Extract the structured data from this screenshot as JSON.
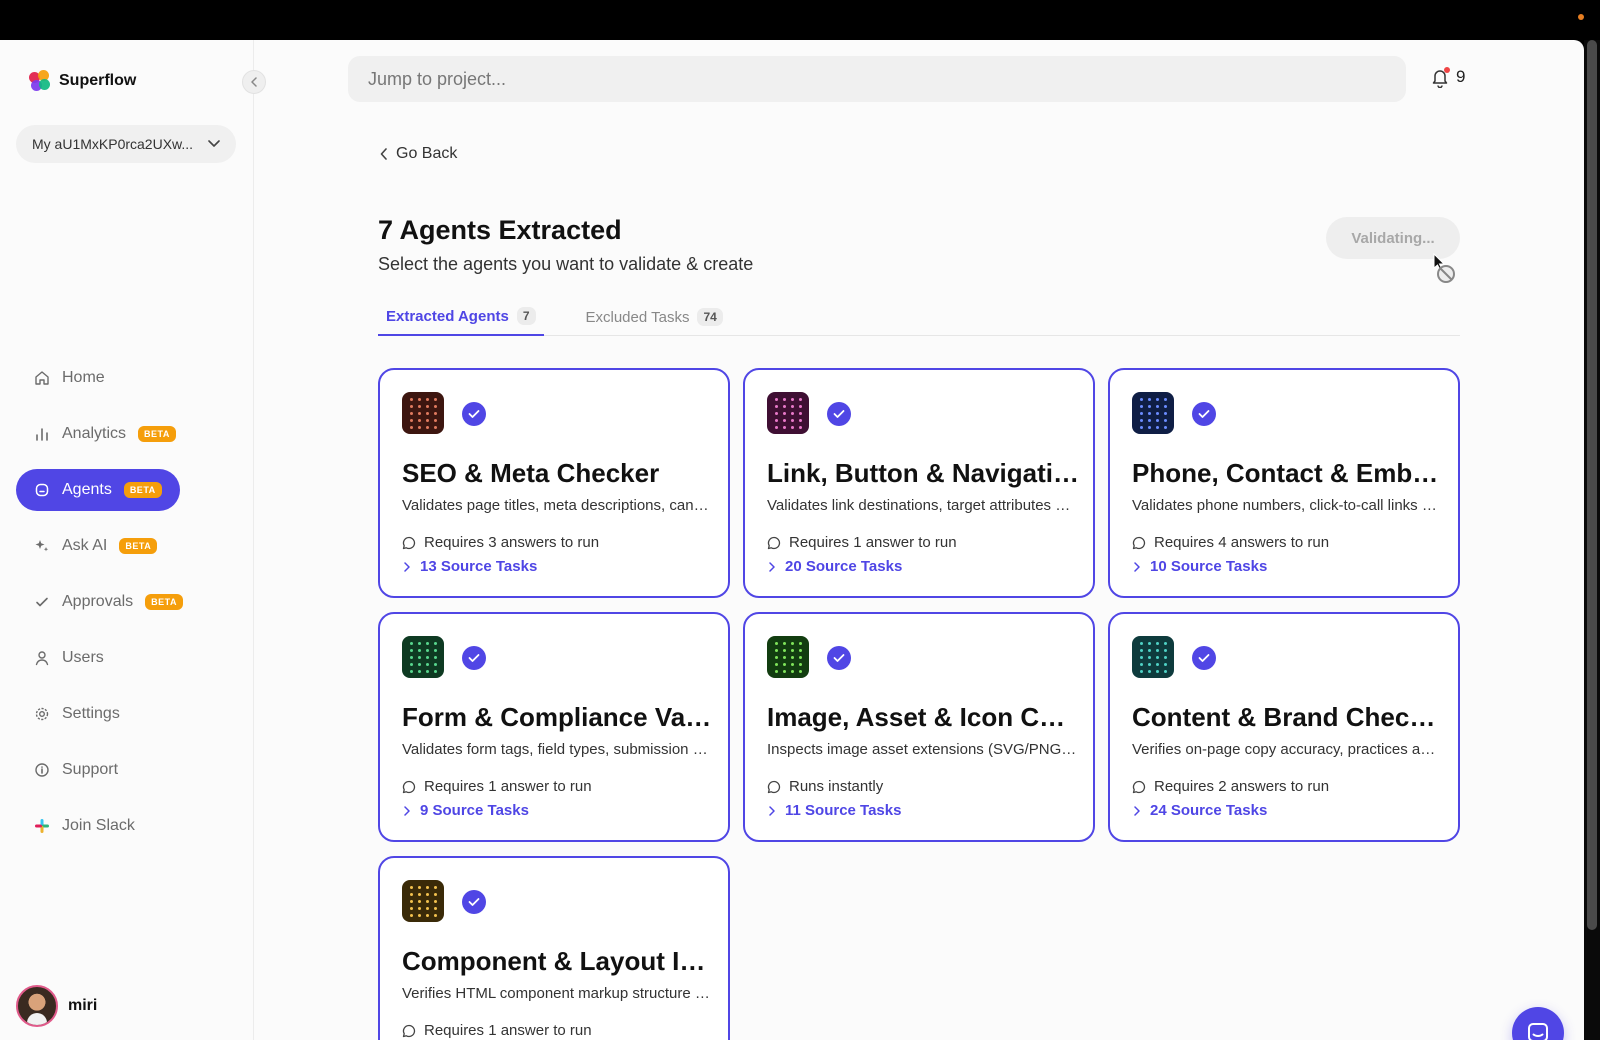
{
  "app": {
    "name": "Superflow"
  },
  "colors": {
    "accent": "#5046e5",
    "beta_badge": "#f59e0b",
    "top_dot": "#e67e22"
  },
  "sidebar": {
    "workspace_label": "My aU1MxKP0rca2UXw...",
    "items": [
      {
        "label": "Home",
        "icon": "home-icon",
        "badge": ""
      },
      {
        "label": "Analytics",
        "icon": "analytics-icon",
        "badge": "BETA"
      },
      {
        "label": "Agents",
        "icon": "agents-icon",
        "badge": "BETA",
        "active": true
      },
      {
        "label": "Ask AI",
        "icon": "sparkle-icon",
        "badge": "BETA"
      },
      {
        "label": "Approvals",
        "icon": "check-icon",
        "badge": "BETA"
      },
      {
        "label": "Users",
        "icon": "user-icon",
        "badge": ""
      },
      {
        "label": "Settings",
        "icon": "gear-icon",
        "badge": ""
      },
      {
        "label": "Support",
        "icon": "info-icon",
        "badge": ""
      },
      {
        "label": "Join Slack",
        "icon": "slack-icon",
        "badge": ""
      }
    ],
    "user": {
      "name": "miri"
    }
  },
  "header": {
    "search_placeholder": "Jump to project...",
    "notification_count": "9"
  },
  "main": {
    "back_label": "Go Back",
    "title": "7 Agents Extracted",
    "subtitle": "Select the agents you want to validate & create",
    "validate_button": "Validating...",
    "tabs": [
      {
        "label": "Extracted Agents",
        "count": "7",
        "active": true
      },
      {
        "label": "Excluded Tasks",
        "count": "74",
        "active": false
      }
    ],
    "agents": [
      {
        "title": "SEO & Meta Checker",
        "description": "Validates page titles, meta descriptions, canonical tags and structured data",
        "requirement": "Requires 3 answers to run",
        "source_tasks": "13 Source Tasks",
        "icon_bg": "#3d1610",
        "icon_dot": "#e07a5f"
      },
      {
        "title": "Link, Button & Navigation Validator",
        "description": "Validates link destinations, target attributes and button behaviour",
        "requirement": "Requires 1 answer to run",
        "source_tasks": "20 Source Tasks",
        "icon_bg": "#3f0f33",
        "icon_dot": "#e879c9"
      },
      {
        "title": "Phone, Contact & Embed Checker",
        "description": "Validates phone numbers, click-to-call links and contact details",
        "requirement": "Requires 4 answers to run",
        "source_tasks": "10 Source Tasks",
        "icon_bg": "#0f1e45",
        "icon_dot": "#6b8cff"
      },
      {
        "title": "Form & Compliance Validator",
        "description": "Validates form tags, field types, submission handling and consent",
        "requirement": "Requires 1 answer to run",
        "source_tasks": "9 Source Tasks",
        "icon_bg": "#0e3a22",
        "icon_dot": "#58d68d"
      },
      {
        "title": "Image, Asset & Icon Checker",
        "description": "Inspects image asset extensions (SVG/PNG) and alt attributes",
        "requirement": "Runs instantly",
        "source_tasks": "11 Source Tasks",
        "icon_bg": "#123d10",
        "icon_dot": "#7fe35a"
      },
      {
        "title": "Content & Brand Checker",
        "description": "Verifies on-page copy accuracy, practices and brand consistency",
        "requirement": "Requires 2 answers to run",
        "source_tasks": "24 Source Tasks",
        "icon_bg": "#0e3b3d",
        "icon_dot": "#4fd1c5"
      },
      {
        "title": "Component & Layout Inspector",
        "description": "Verifies HTML component markup structure and layout",
        "requirement": "Requires 1 answer to run",
        "source_tasks": "",
        "icon_bg": "#3a2a08",
        "icon_dot": "#f2c14e"
      }
    ]
  }
}
